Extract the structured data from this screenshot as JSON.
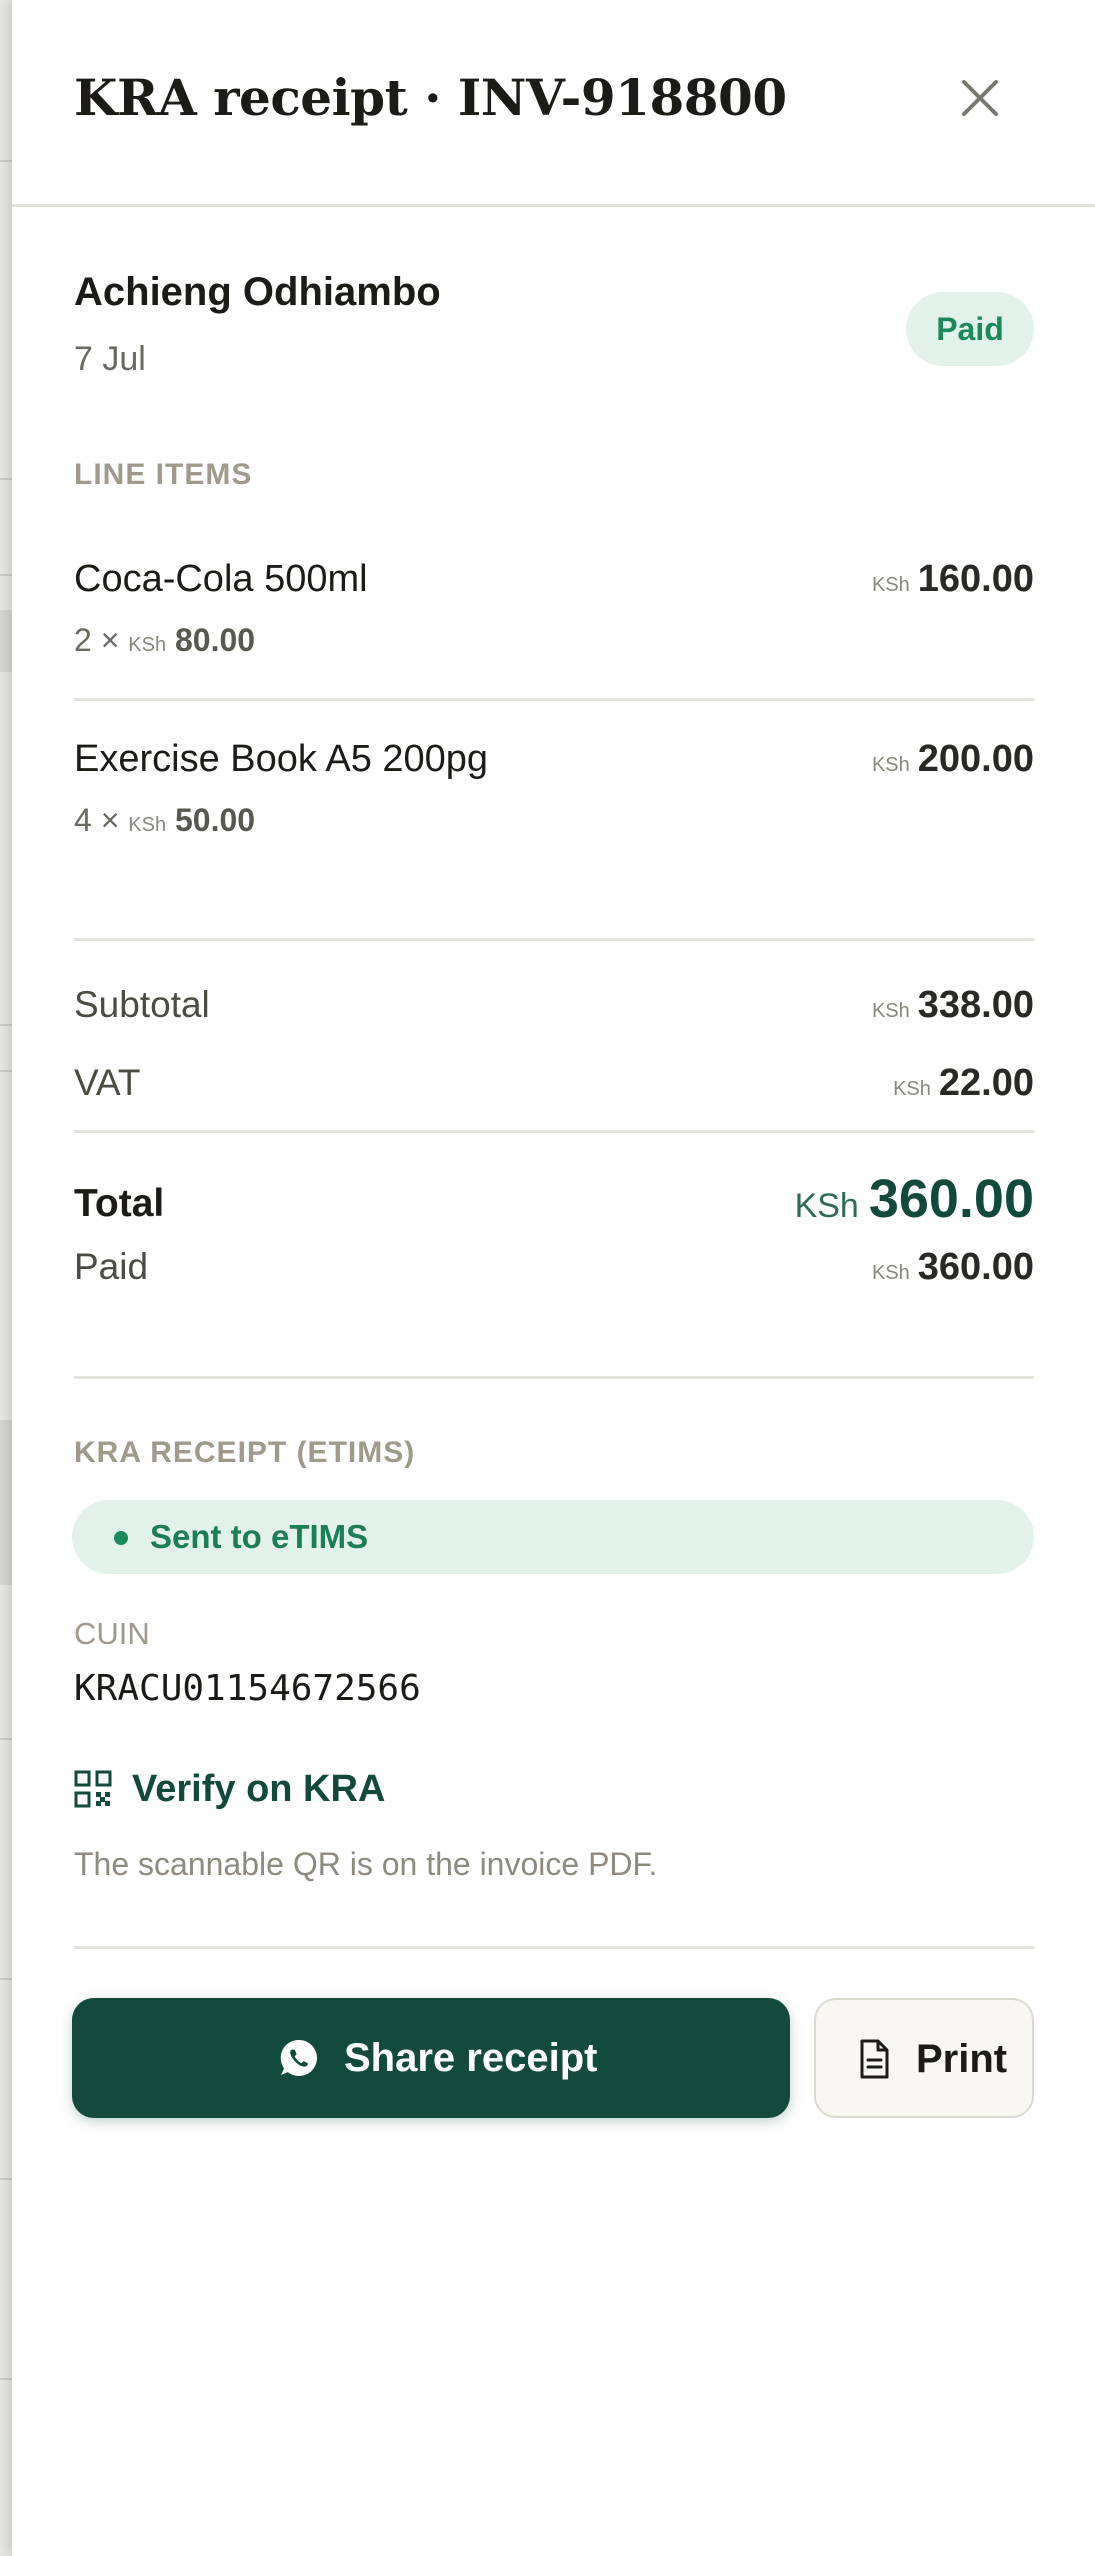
{
  "header": {
    "title": "KRA receipt · INV-918800",
    "close_icon": "close-icon"
  },
  "customer": {
    "name": "Achieng Odhiambo",
    "date": "7 Jul",
    "status": "Paid"
  },
  "line_items_label": "LINE ITEMS",
  "currency": "KSh",
  "line_items": [
    {
      "name": "Coca-Cola 500ml",
      "qty": "2 ×",
      "unit_price": "80.00",
      "amount": "160.00"
    },
    {
      "name": "Exercise Book A5 200pg",
      "qty": "4 ×",
      "unit_price": "50.00",
      "amount": "200.00"
    }
  ],
  "totals": {
    "subtotal_label": "Subtotal",
    "subtotal": "338.00",
    "vat_label": "VAT",
    "vat": "22.00",
    "total_label": "Total",
    "total": "360.00",
    "paid_label": "Paid",
    "paid": "360.00"
  },
  "etims": {
    "section_label": "KRA RECEIPT (ETIMS)",
    "status": "Sent to eTIMS",
    "cuin_label": "CUIN",
    "cuin": "KRACU01154672566",
    "verify_label": "Verify on KRA",
    "qr_note": "The scannable QR is on the invoice PDF."
  },
  "actions": {
    "share_label": "Share receipt",
    "print_label": "Print"
  },
  "colors": {
    "brand": "#124b3c",
    "success": "#1b8a5a",
    "success_bg": "#e2f1e9",
    "muted": "#a09a8c"
  },
  "icons": {
    "verify": "qr-code-icon",
    "share": "whatsapp-icon",
    "print": "document-icon"
  }
}
